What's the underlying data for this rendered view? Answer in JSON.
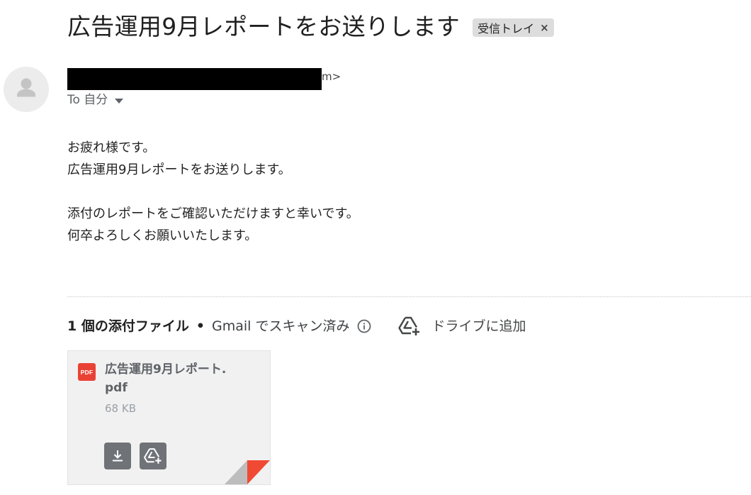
{
  "email": {
    "subject": "広告運用9月レポートをお送りします",
    "label": "受信トレイ",
    "label_close": "×",
    "sender_tail": "m>",
    "recipient": "To 自分",
    "body_lines": [
      "お疲れ様です。",
      "広告運用9月レポートをお送りします。",
      "",
      "添付のレポートをご確認いただけますと幸いです。",
      "何卒よろしくお願いいたします。"
    ]
  },
  "attachments": {
    "count_label": "1 個の添付ファイル",
    "separator": "•",
    "scan_label": "Gmail でスキャン済み",
    "drive_add_label": "ドライブに追加",
    "files": [
      {
        "type_badge": "PDF",
        "name": "広告運用9月レポート.pdf",
        "size": "68 KB"
      }
    ]
  },
  "icons": {
    "avatar": "person-icon",
    "info": "info-icon",
    "drive_add": "drive-add-icon",
    "download": "download-icon",
    "card_drive": "drive-add-icon"
  },
  "colors": {
    "pdf_red": "#e94235",
    "chip_bg": "#dddddd",
    "card_bg": "#f1f1f1",
    "button_bg": "#6f7378",
    "fold_red": "#f04a34"
  }
}
